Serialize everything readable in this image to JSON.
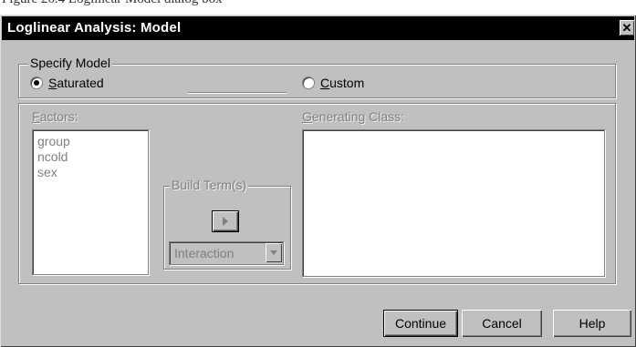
{
  "caption": "Figure 26.4 Loglinear Model dialog box",
  "window": {
    "title": "Loglinear Analysis: Model",
    "close_glyph": "✕"
  },
  "specify_model": {
    "legend": "Specify Model",
    "saturated": {
      "first": "S",
      "rest": "aturated",
      "selected": true
    },
    "custom": {
      "first": "C",
      "rest": "ustom",
      "selected": false
    }
  },
  "factors": {
    "label_first": "F",
    "label_rest": "actors:",
    "items": [
      "group",
      "ncold",
      "sex"
    ]
  },
  "build_terms": {
    "legend": "Build Term(s)",
    "button_icon": "play-arrow-icon",
    "combo_value": "Interaction"
  },
  "generating_class": {
    "label_first": "G",
    "label_rest": "enerating Class:"
  },
  "buttons": {
    "continue": "Continue",
    "cancel": "Cancel",
    "help": "Help"
  }
}
